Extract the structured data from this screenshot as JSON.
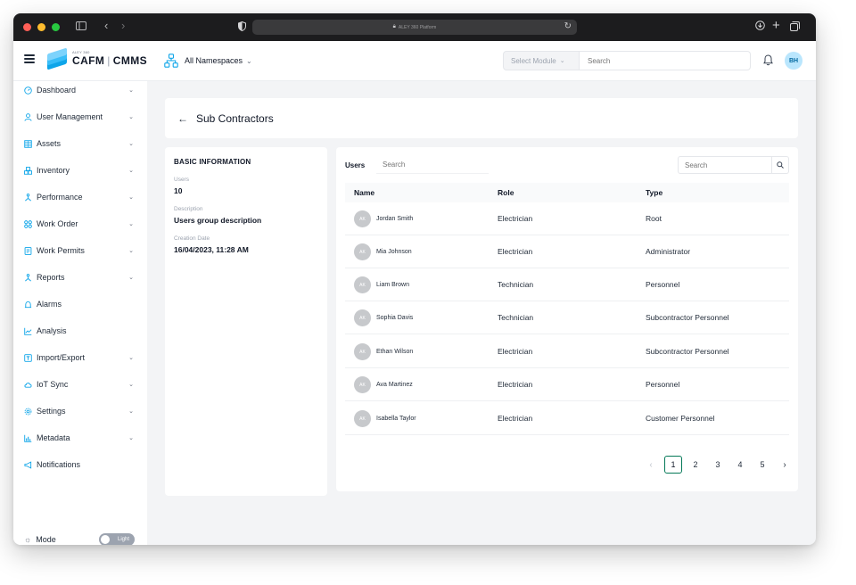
{
  "browser": {
    "address_text": "ALEY 360 Platform"
  },
  "header": {
    "logo_superscript": "ALEY 360",
    "logo_primary": "CAFM",
    "logo_secondary": "CMMS",
    "namespace_label": "All Namespaces",
    "module_select_placeholder": "Select Module",
    "search_placeholder": "Search",
    "user_initials": "BH"
  },
  "sidebar": {
    "items": [
      {
        "label": "Dashboard",
        "icon": "dashboard-icon",
        "expandable": true
      },
      {
        "label": "User Management",
        "icon": "user-icon",
        "expandable": true
      },
      {
        "label": "Assets",
        "icon": "grid-icon",
        "expandable": true
      },
      {
        "label": "Inventory",
        "icon": "boxes-icon",
        "expandable": true
      },
      {
        "label": "Performance",
        "icon": "performance-icon",
        "expandable": true
      },
      {
        "label": "Work Order",
        "icon": "work-order-icon",
        "expandable": true
      },
      {
        "label": "Work Permits",
        "icon": "permit-icon",
        "expandable": true
      },
      {
        "label": "Reports",
        "icon": "reports-icon",
        "expandable": true
      },
      {
        "label": "Alarms",
        "icon": "alarm-icon",
        "expandable": false
      },
      {
        "label": "Analysis",
        "icon": "chart-icon",
        "expandable": false
      },
      {
        "label": "Import/Export",
        "icon": "import-export-icon",
        "expandable": true
      },
      {
        "label": "IoT Sync",
        "icon": "cloud-sync-icon",
        "expandable": true
      },
      {
        "label": "Settings",
        "icon": "gear-icon",
        "expandable": true
      },
      {
        "label": "Metadata",
        "icon": "bar-chart-icon",
        "expandable": true
      },
      {
        "label": "Notifications",
        "icon": "megaphone-icon",
        "expandable": false
      }
    ],
    "mode_label": "Mode",
    "mode_value": "Light"
  },
  "page": {
    "title": "Sub Contractors"
  },
  "basic_info": {
    "section_title": "BASIC INFORMATION",
    "fields": [
      {
        "label": "Users",
        "value": "10"
      },
      {
        "label": "Description",
        "value": "Users group description"
      },
      {
        "label": "Creation Date",
        "value": "16/04/2023, 11:28 AM"
      }
    ]
  },
  "users_panel": {
    "label": "Users",
    "search_placeholder": "Search",
    "right_search_placeholder": "Search",
    "columns": [
      "Name",
      "Role",
      "Type"
    ],
    "rows": [
      {
        "initials": "AK",
        "name": "Jordan Smith",
        "role": "Electrician",
        "type": "Root"
      },
      {
        "initials": "AK",
        "name": "Mia Johnson",
        "role": "Electrician",
        "type": "Administrator"
      },
      {
        "initials": "AK",
        "name": "Liam Brown",
        "role": "Technician",
        "type": "Personnel"
      },
      {
        "initials": "AK",
        "name": "Sophia Davis",
        "role": "Technician",
        "type": "Subcontractor Personnel"
      },
      {
        "initials": "AK",
        "name": "Ethan Wilson",
        "role": "Electrician",
        "type": "Subcontractor Personnel"
      },
      {
        "initials": "AK",
        "name": "Ava Martinez",
        "role": "Electrician",
        "type": "Personnel"
      },
      {
        "initials": "AK",
        "name": "Isabella Taylor",
        "role": "Electrician",
        "type": "Customer Personnel"
      }
    ],
    "pagination": {
      "pages": [
        "1",
        "2",
        "3",
        "4",
        "5"
      ],
      "current": "1"
    }
  },
  "colors": {
    "accent_green": "#047857",
    "logo_blue": "#0ea5e9",
    "avatar_grey": "#c7c9cc"
  }
}
